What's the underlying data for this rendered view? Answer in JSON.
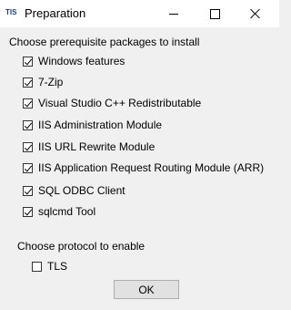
{
  "window": {
    "title": "Preparation",
    "icon_text": "TIS",
    "controls": [
      "minimize",
      "maximize",
      "close"
    ]
  },
  "packages": {
    "label": "Choose prerequisite packages to install",
    "items": [
      {
        "label": "Windows features",
        "checked": true
      },
      {
        "label": "7-Zip",
        "checked": true
      },
      {
        "label": "Visual Studio C++ Redistributable",
        "checked": true
      },
      {
        "label": "IIS Administration Module",
        "checked": true
      },
      {
        "label": "IIS URL Rewrite Module",
        "checked": true
      },
      {
        "label": "IIS Application Request Routing Module (ARR)",
        "checked": true
      },
      {
        "label": "SQL ODBC Client",
        "checked": true
      },
      {
        "label": "sqlcmd Tool",
        "checked": true
      }
    ]
  },
  "protocol": {
    "label": "Choose protocol to enable",
    "items": [
      {
        "label": "TLS",
        "checked": false
      }
    ]
  },
  "buttons": {
    "ok": "OK"
  }
}
